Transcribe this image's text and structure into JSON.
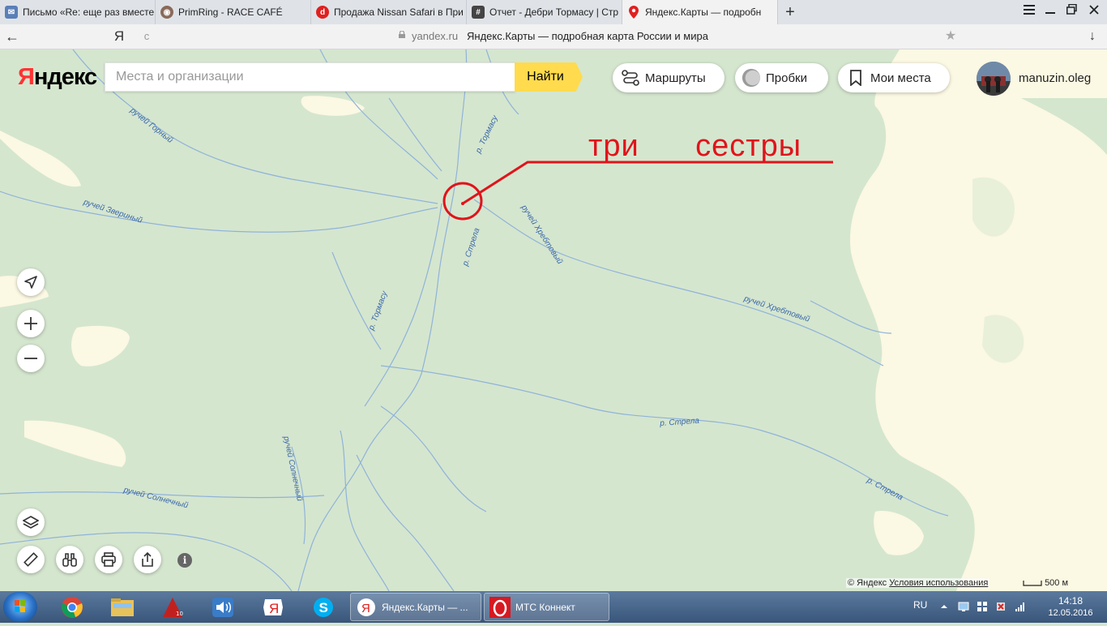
{
  "browser": {
    "tabs": [
      {
        "title": "Письмо «Re: еще раз вместе",
        "icon": "mail-icon",
        "color": "#5a7fb8"
      },
      {
        "title": "PrimRing - RACE CAFÉ",
        "icon": "primring-icon",
        "color": "#8a6a5a"
      },
      {
        "title": "Продажа Nissan Safari в При",
        "icon": "drom-icon",
        "color": "#e02020"
      },
      {
        "title": "Отчет - Дебри Тормасу | Стр",
        "icon": "forum-icon",
        "color": "#444444"
      },
      {
        "title": "Яндекс.Карты — подробн",
        "icon": "map-pin-icon",
        "color": "#e02020",
        "active": true
      }
    ],
    "new_tab": "+",
    "back": "←",
    "yandex_button": "Я",
    "reload": "c",
    "host": "yandex.ru",
    "page_title": "Яндекс.Карты — подробная карта России и мира",
    "star": "★",
    "download": "↓"
  },
  "map": {
    "logo_ya": "Я",
    "logo_rest": "ндекс",
    "search_placeholder": "Места и организации",
    "search_button": "Найти",
    "routes_label": "Маршруты",
    "traffic_label": "Пробки",
    "my_places_label": "Мои места",
    "username": "manuzin.oleg",
    "annotation": "три      сестры",
    "copyright_prefix": "© Яндекс",
    "terms_link": "Условия использования",
    "scale_label": "500 м",
    "info": "i",
    "labels": [
      {
        "text": "ручей Горный"
      },
      {
        "text": "р. Тормасу"
      },
      {
        "text": "ручей Звериный"
      },
      {
        "text": "ручей Хребтовый"
      },
      {
        "text": "р. Стрела"
      },
      {
        "text": "р. Тормасу"
      },
      {
        "text": "ручей Хребтовый"
      },
      {
        "text": "р. Стрела"
      },
      {
        "text": "ручей Солнечный"
      },
      {
        "text": "ручей Солнечный"
      },
      {
        "text": "р. Стрела"
      }
    ],
    "colors": {
      "forest": "#d5e6cf",
      "field": "#fbf8e3",
      "water": "#8fb3d8",
      "annotation": "#e0141b",
      "accent": "#ffdb4d"
    }
  },
  "taskbar": {
    "apps": [
      {
        "name": "chrome-icon"
      },
      {
        "name": "explorer-icon"
      },
      {
        "name": "autocad-icon"
      },
      {
        "name": "audio-icon"
      },
      {
        "name": "yandex-browser-icon"
      },
      {
        "name": "skype-icon"
      }
    ],
    "windows": [
      {
        "title": "Яндекс.Карты — ...",
        "icon": "yandex-browser-icon"
      },
      {
        "title": "МТС Коннект",
        "icon": "mts-connect-icon"
      }
    ],
    "lang": "RU",
    "time": "14:18",
    "date": "12.05.2016"
  }
}
